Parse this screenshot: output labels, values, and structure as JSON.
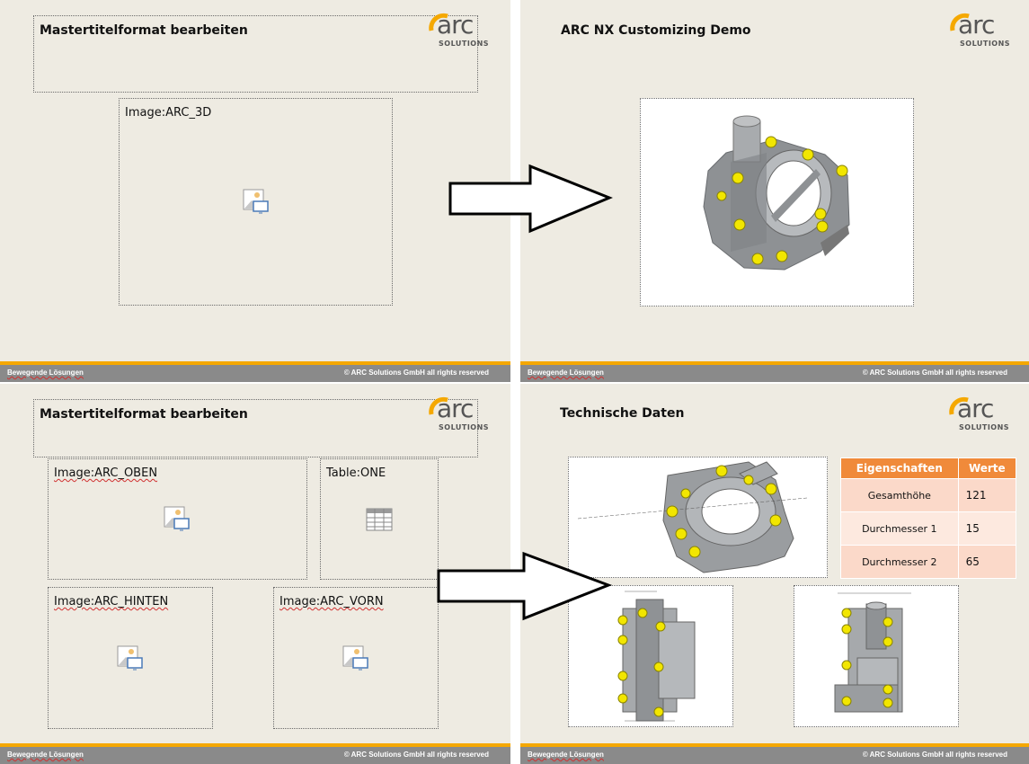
{
  "slide_tl": {
    "title": "Mastertitelformat bearbeiten",
    "placeholder_label": "Image:ARC_3D",
    "footer_left": "Bewegende Lösungen",
    "footer_right": "© ARC Solutions GmbH all rights reserved"
  },
  "slide_tr": {
    "title": "ARC NX Customizing Demo",
    "footer_left": "Bewegende Lösungen",
    "footer_right": "© ARC Solutions GmbH all rights reserved"
  },
  "slide_bl": {
    "title": "Mastertitelformat bearbeiten",
    "placeholders": [
      "Image:ARC_OBEN",
      "Table:ONE",
      "Image:ARC_HINTEN",
      "Image:ARC_VORN"
    ],
    "footer_left": "Bewegende Lösungen",
    "footer_right": "© ARC Solutions GmbH all rights reserved"
  },
  "slide_br": {
    "title": "Technische Daten",
    "table": {
      "headers": [
        "Eigenschaften",
        "Werte"
      ],
      "rows": [
        [
          "Gesamthöhe",
          "121"
        ],
        [
          "Durchmesser 1",
          "15"
        ],
        [
          "Durchmesser 2",
          "65"
        ]
      ]
    },
    "footer_left": "Bewegende Lösungen",
    "footer_right": "© ARC Solutions GmbH all rights reserved"
  },
  "logo": {
    "text": "arc",
    "sub": "SOLUTIONS"
  },
  "colors": {
    "slide_bg": "#eeebe2",
    "accent": "#f5a800",
    "footer": "#8a8a8a",
    "table_header": "#f08a3a"
  }
}
